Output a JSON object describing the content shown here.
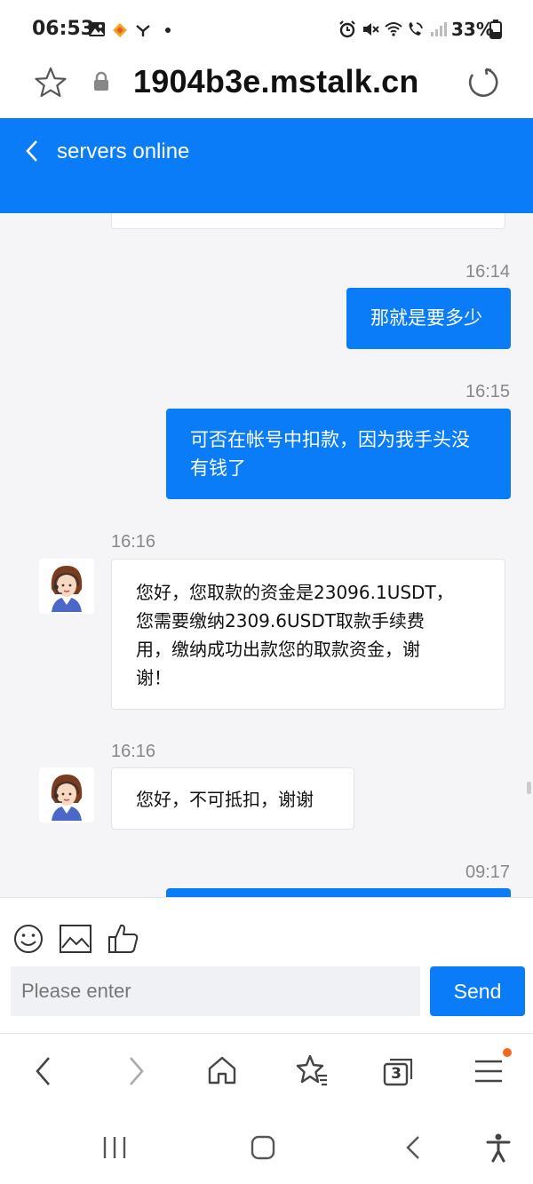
{
  "status_bar": {
    "time": "06:53",
    "battery": "33%"
  },
  "address_bar": {
    "url": "1904b3e.mstalk.cn"
  },
  "chat_header": {
    "title": "servers online"
  },
  "messages": [
    {
      "time": "16:14",
      "direction": "out",
      "lines": [
        "那就是要多少"
      ]
    },
    {
      "time": "16:15",
      "direction": "out",
      "lines": [
        "可否在帐号中扣款，因为我手头没",
        "有钱了"
      ]
    },
    {
      "time": "16:16",
      "direction": "in",
      "lines": [
        "您好，您取款的资金是23096.1USDT，",
        "您需要缴纳2309.6USDT取款手续费",
        "用，缴纳成功出款您的取款资金，谢",
        "谢！"
      ]
    },
    {
      "time": "16:16",
      "direction": "in",
      "lines": [
        "您好，不可抵扣，谢谢"
      ]
    },
    {
      "time": "09:17",
      "direction": "out",
      "lines": []
    }
  ],
  "input": {
    "placeholder": "Please enter",
    "send_label": "Send"
  },
  "toolbar": {
    "tabs_count": "3"
  },
  "colors": {
    "accent": "#0b7cf7",
    "chat_bg": "#f5f5f7",
    "badge": "#f26a1b"
  }
}
